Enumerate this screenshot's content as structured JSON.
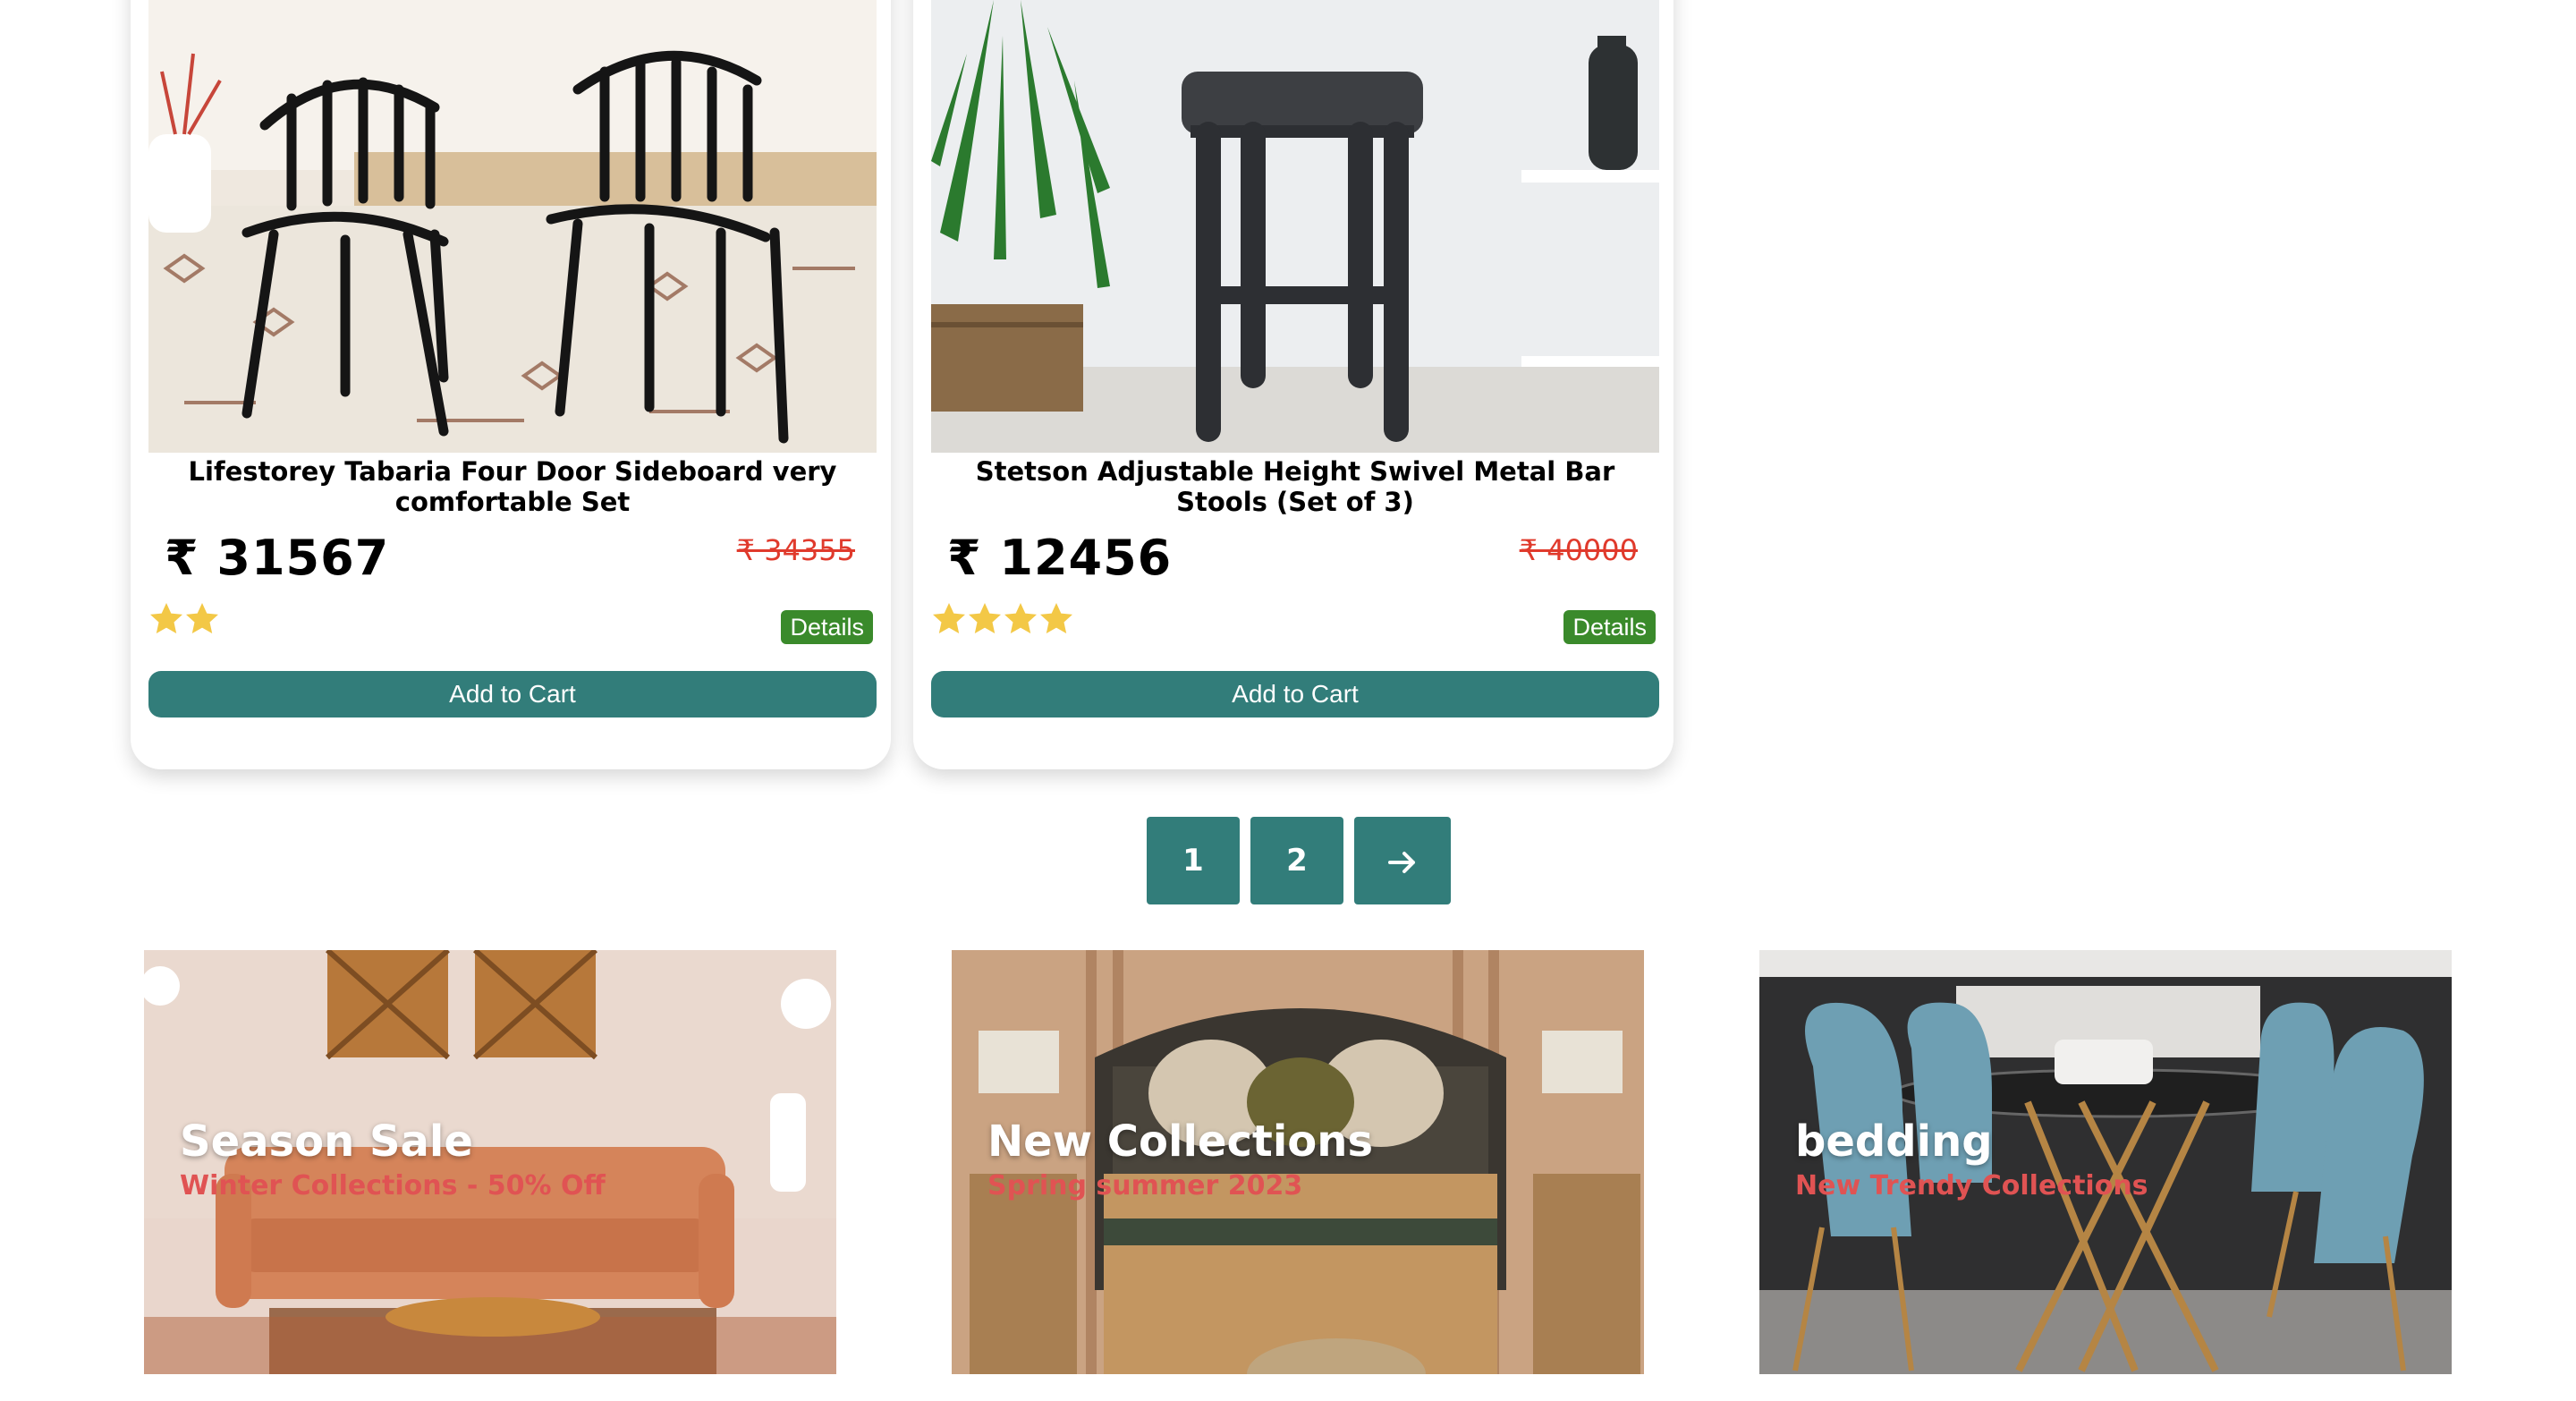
{
  "products": [
    {
      "title": "Lifestorey Tabaria Four Door Sideboard very comfortable Set",
      "price": "₹ 31567",
      "old_price": "₹ 34355",
      "rating": 2,
      "details_label": "Details",
      "cart_label": "Add to Cart",
      "image": "two black spindle-back chairs on patterned rug"
    },
    {
      "title": "Stetson Adjustable Height Swivel Metal Bar Stools (Set of 3)",
      "price": "₹ 12456",
      "old_price": "₹ 40000",
      "rating": 4,
      "details_label": "Details",
      "cart_label": "Add to Cart",
      "image": "dark upholstered bar stool beside plant"
    }
  ],
  "pagination": {
    "pages": [
      "1",
      "2"
    ],
    "next_icon": "arrow-right-icon"
  },
  "banners": [
    {
      "title": "Season Sale",
      "subtitle": "Winter Collections - 50% Off"
    },
    {
      "title": "New Collections",
      "subtitle": "Spring summer 2023"
    },
    {
      "title": "bedding",
      "subtitle": "New Trendy Collections"
    }
  ],
  "colors": {
    "accent": "#327d7a",
    "details": "#3a8a2b",
    "old_price": "#e03a2c",
    "star": "#f3c846",
    "subtitle": "#e05353"
  }
}
